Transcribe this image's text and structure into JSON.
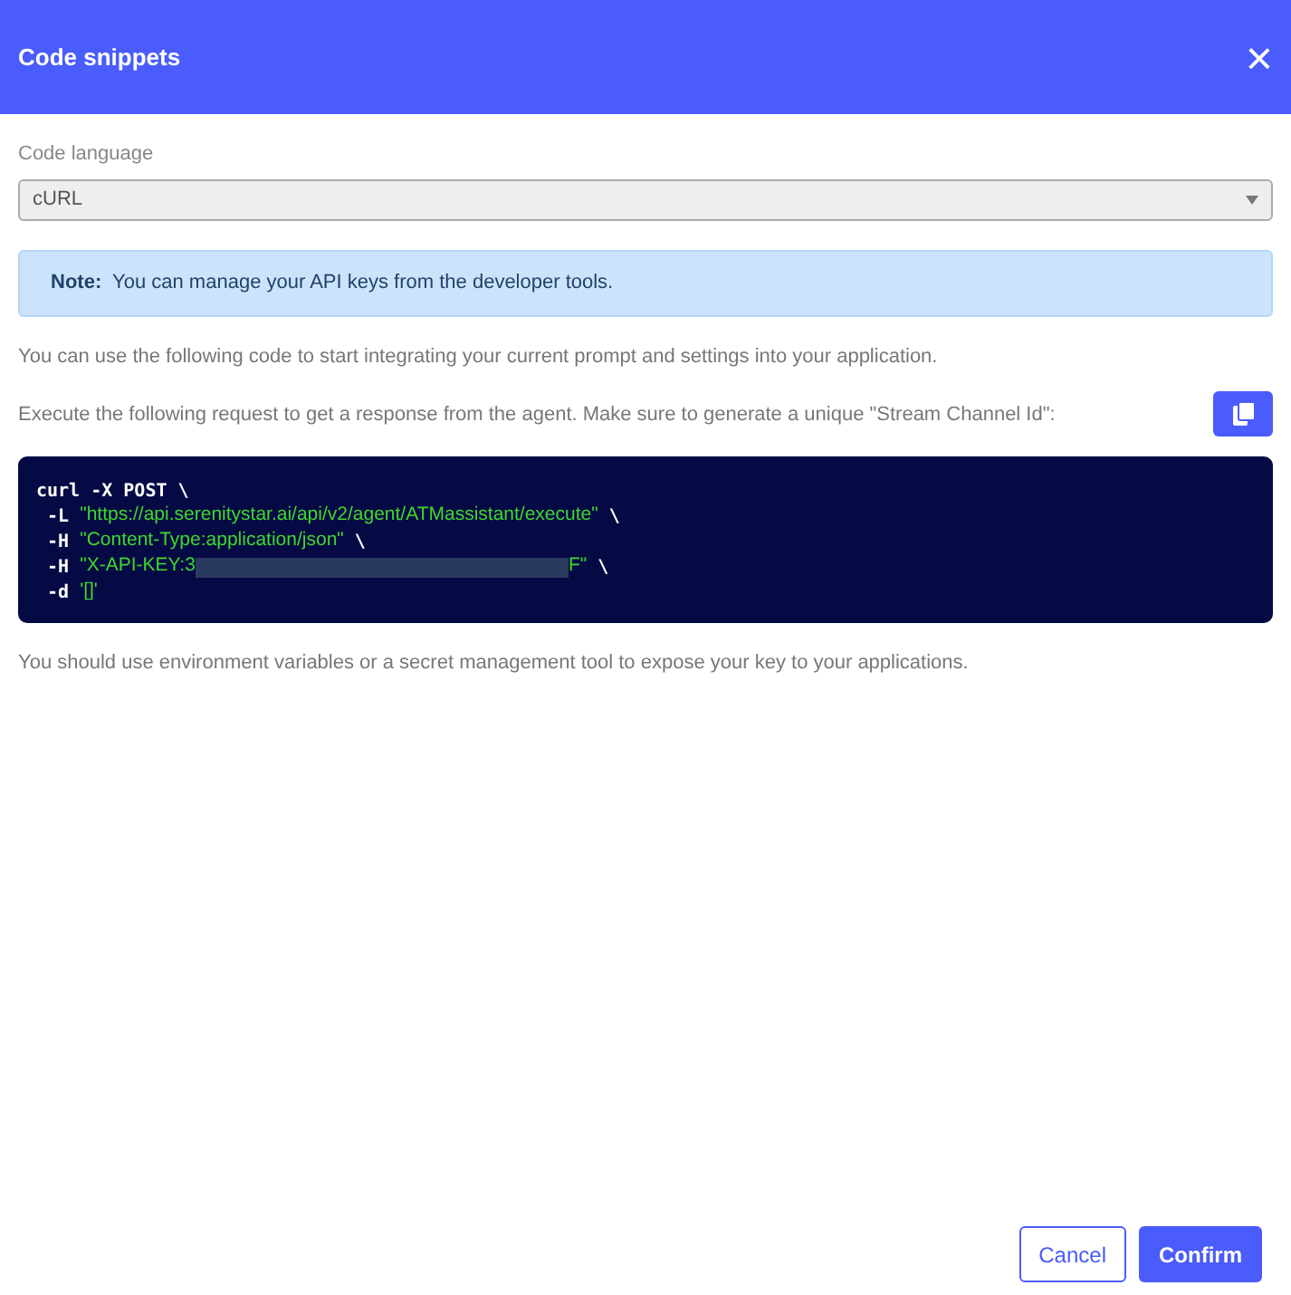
{
  "dialog": {
    "title": "Code snippets",
    "close": "×"
  },
  "language": {
    "label": "Code language",
    "value": "cURL"
  },
  "note": "**Note:**  You can manage your API keys from the developer tools.",
  "intro": "You can use the following code to start integrating your current prompt and settings into your application.",
  "instruction": "Execute the following request to get a response from the agent. Make sure to generate a unique \"Stream Channel Id\":",
  "code_lines": [
    [
      {
        "kind": "flag",
        "text": "curl -X POST \\"
      }
    ],
    [
      {
        "kind": "flag",
        "text": " -L "
      },
      {
        "kind": "string",
        "text": "\"https://api.serenitystar.ai/api/v2/agent/ATMassistant/execute\""
      },
      {
        "kind": "flag",
        "text": " \\"
      }
    ],
    [
      {
        "kind": "flag",
        "text": " -H "
      },
      {
        "kind": "string",
        "text": "\"Content-Type:application/json\""
      },
      {
        "kind": "flag",
        "text": " \\"
      }
    ],
    [
      {
        "kind": "flag",
        "text": " -H "
      },
      {
        "kind": "string",
        "text": "\"X-API-KEY:3"
      },
      {
        "kind": "redacted"
      },
      {
        "kind": "string",
        "text": "F\""
      },
      {
        "kind": "flag",
        "text": " \\"
      }
    ],
    [
      {
        "kind": "flag",
        "text": " -d "
      },
      {
        "kind": "string",
        "text": "'[]'"
      }
    ]
  ],
  "footnote": "You should use environment variables or a secret management tool to expose your key to your applications.",
  "buttons": [
    {
      "kind": "secondary",
      "label": "Cancel"
    },
    {
      "kind": "primary",
      "label": "Confirm"
    }
  ]
}
